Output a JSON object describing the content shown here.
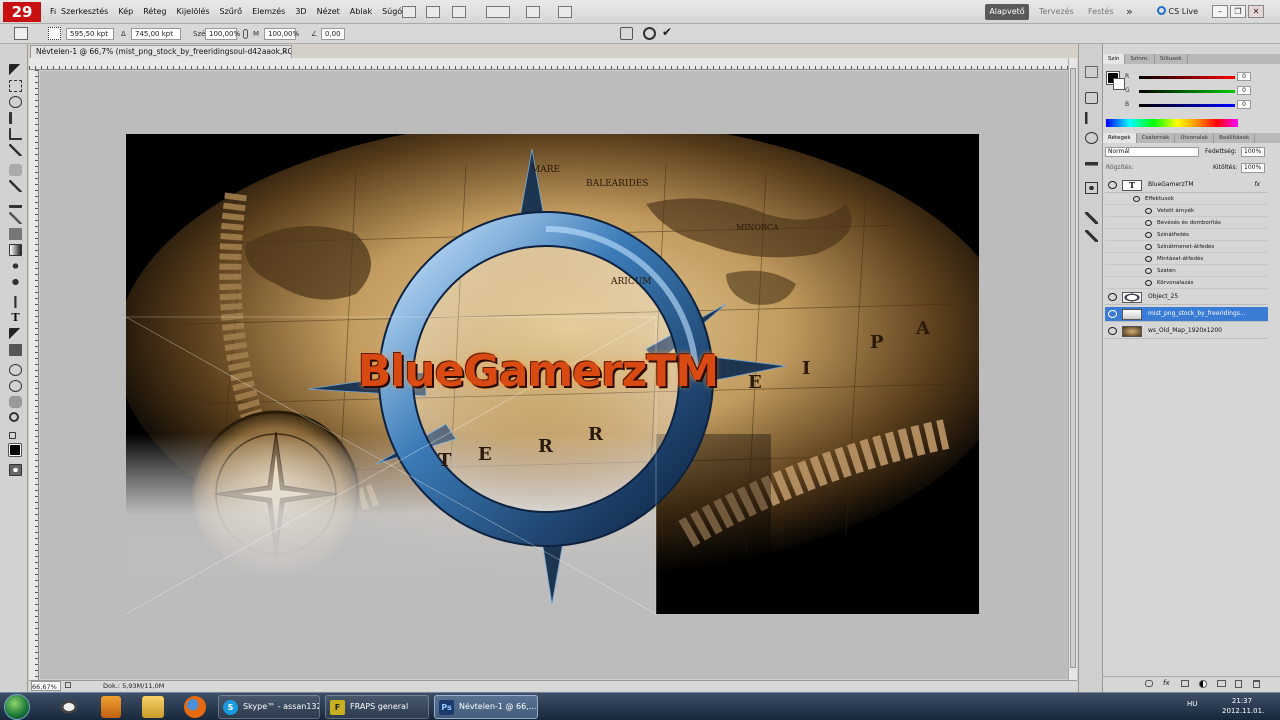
{
  "app": {
    "logo": "29",
    "menu": [
      "Fájl",
      "Szerkesztés",
      "Kép",
      "Réteg",
      "Kijelölés",
      "Szűrő",
      "Elemzés",
      "3D",
      "Nézet",
      "Ablak",
      "Súgó"
    ],
    "workspaces": [
      "Alapvető",
      "Tervezés",
      "Festés"
    ],
    "more_workspaces": "»",
    "cs_live": "CS Live",
    "window_controls": [
      "–",
      "❐",
      "✕"
    ]
  },
  "options": {
    "x": "595,50 kpt",
    "y": "745,00 kpt",
    "w": "100,00%",
    "h": "100,00%",
    "angle": "0,00",
    "w_label": "Szé",
    "h_label": "M",
    "delta_label": "Δ",
    "angle_label": "∠"
  },
  "document": {
    "tab_title": "Névtelen-1 @ 66,7% (mist_png_stock_by_freeridingsoul-d42aaok,RGB/8) *",
    "zoom": "66,67%",
    "doc_info": "Dok.: 5,93M/11,0M",
    "logo_text": "BlueGamerzTM",
    "map_words": [
      "T",
      "E",
      "R",
      "R",
      "E",
      "I",
      "P",
      "A"
    ],
    "map_small": [
      "MARE",
      "BALEARIDES",
      "MINORCA",
      "ARICUM"
    ]
  },
  "panels": {
    "color_tabs": [
      "Szín",
      "Színm.",
      "Stílusok"
    ],
    "color_channels": [
      {
        "label": "R",
        "value": "0",
        "color": "#e31b1b"
      },
      {
        "label": "G",
        "value": "0",
        "color": "#1bb31b"
      },
      {
        "label": "B",
        "value": "0",
        "color": "#1b3be3"
      }
    ],
    "layers_tabs": [
      "Rétegek",
      "Csatornák",
      "Útvonalak",
      "Beállítások"
    ],
    "blend_mode": "Normál",
    "opacity_label": "Fedettség:",
    "opacity": "100%",
    "lock_label": "Rögzítés:",
    "fill_label": "Kitöltés:",
    "fill": "100%",
    "layers": [
      {
        "name": "BlueGamerzTM",
        "type": "text",
        "fx": "fx",
        "selected": false
      },
      {
        "name": "Object_25",
        "type": "image",
        "selected": false
      },
      {
        "name": "mist_png_stock_by_freeridings...",
        "type": "image",
        "selected": true
      },
      {
        "name": "ws_Old_Map_1920x1200",
        "type": "image",
        "selected": false
      }
    ],
    "effects_header": "Effektusok",
    "effects": [
      "Vetett árnyék",
      "Bevésés és domborítás",
      "Színátfedés",
      "Színátmenet-átfedés",
      "Mintázat-átfedés",
      "Szatén",
      "Körvonalazás"
    ]
  },
  "taskbar": {
    "tasks": [
      "Skype™ - assan132",
      "FRAPS general",
      "Névtelen-1 @ 66,..."
    ],
    "lang": "HU",
    "time": "21:37",
    "date": "2012.11.01."
  },
  "colors": {
    "selection": "#3a7bd5",
    "ps_red": "#c81010",
    "active_workspace": "#5a5a5a"
  }
}
